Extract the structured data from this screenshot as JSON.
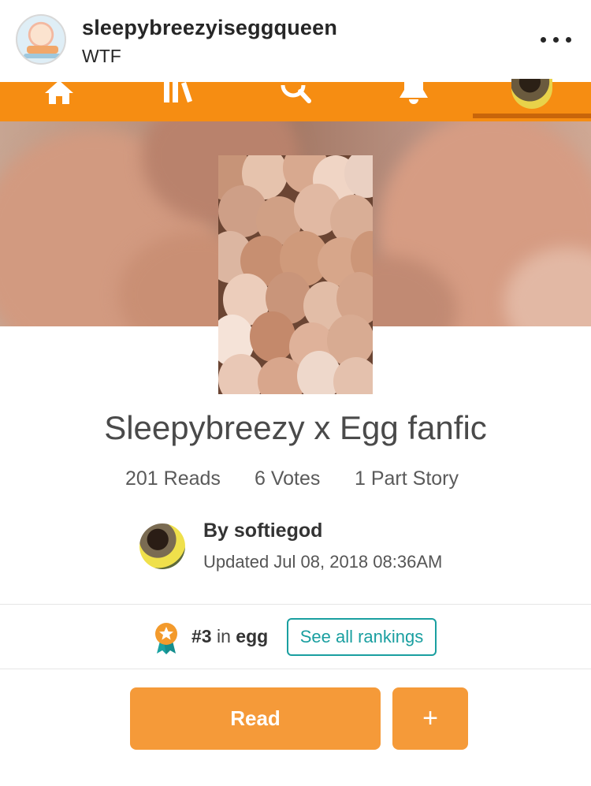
{
  "post": {
    "username": "sleepybreezyiseggqueen",
    "location": "WTF",
    "more_icon": "more-horizontal-icon"
  },
  "nav": {
    "accent_color": "#f68d12",
    "items": [
      {
        "name": "home",
        "icon": "home-icon"
      },
      {
        "name": "library",
        "icon": "library-icon"
      },
      {
        "name": "search",
        "icon": "search-icon"
      },
      {
        "name": "notifications",
        "icon": "bell-icon"
      },
      {
        "name": "profile",
        "icon": "profile-avatar-icon",
        "active": true
      }
    ]
  },
  "story": {
    "title": "Sleepybreezy x Egg fanfic",
    "reads": "201 Reads",
    "votes": "6 Votes",
    "parts": "1 Part Story",
    "author": "By softiegod",
    "updated": "Updated Jul 08, 2018 08:36AM"
  },
  "ranking": {
    "rank": "#3",
    "in_text": " in ",
    "tag": "egg",
    "see_all_label": "See all rankings",
    "badge_icon": "ranking-medal-icon",
    "accent_color": "#1a9fa0"
  },
  "actions": {
    "read_label": "Read",
    "add_label": "+",
    "button_color": "#f59a39"
  }
}
